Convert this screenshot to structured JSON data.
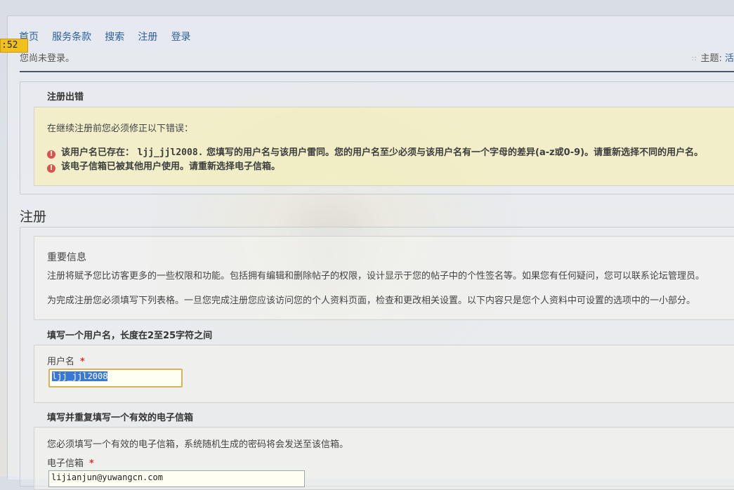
{
  "clock": ":52",
  "nav": [
    "首页",
    "服务条款",
    "搜索",
    "注册",
    "登录"
  ],
  "login_status": "您尚未登录。",
  "theme": {
    "label": "主题:",
    "value": "活"
  },
  "error_panel": {
    "title": "注册出错",
    "intro": "在继续注册前您必须修正以下错误：",
    "errors": [
      {
        "prefix": "该用户名已存在：",
        "username": "ljj_jjl2008.",
        "text": "您填写的用户名与该用户雷同。您的用户名至少必须与该用户名有一个字母的差异(a-z或0-9)。请重新选择不同的用户名。"
      },
      {
        "text": "该电子信箱已被其他用户使用。请重新选择电子信箱。"
      }
    ]
  },
  "register": {
    "heading": "注册",
    "info_title": "重要信息",
    "info_p1": "注册将赋予您比访客更多的一些权限和功能。包括拥有编辑和删除帖子的权限，设计显示于您的帖子中的个性签名等。如果您有任何疑问，您可以联系论坛管理员。",
    "info_p2": "为完成注册您必须填写下列表格。一旦您完成注册您应该访问您的个人资料页面，检查和更改相关设置。以下内容只是您个人资料中可设置的选项中的一小部分。"
  },
  "username_section": {
    "title": "填写一个用户名，长度在2至25字符之间",
    "label": "用户名",
    "required": "*",
    "value": "ljj_jjl2008"
  },
  "email_section": {
    "title": "填写并重复填写一个有效的电子信箱",
    "note": "您必须填写一个有效的电子信箱，系统随机生成的密码将会发送至该信箱。",
    "label": "电子信箱",
    "required": "*",
    "value": "lijianjun@yuwangcn.com"
  }
}
